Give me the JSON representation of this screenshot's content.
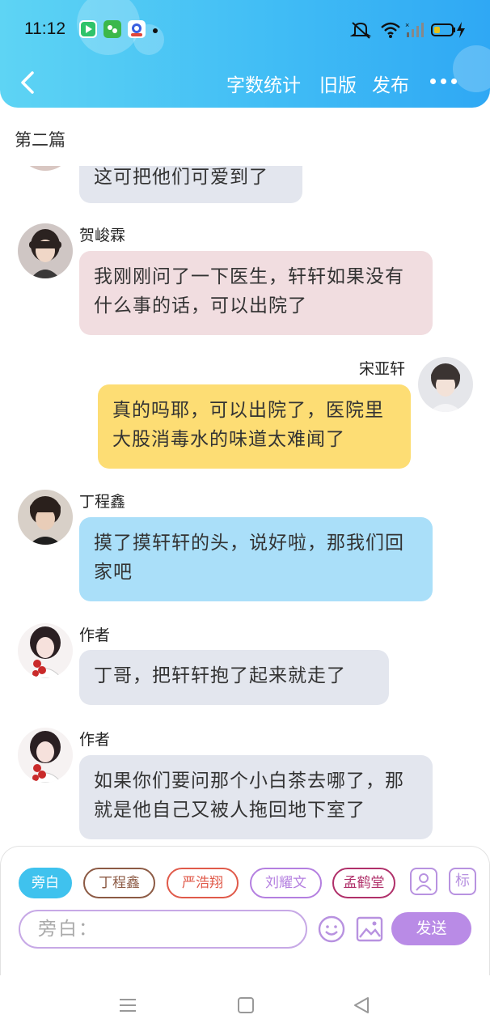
{
  "status_bar": {
    "time": "11:12"
  },
  "nav": {
    "items": [
      {
        "label": "字数统计"
      },
      {
        "label": "旧版"
      },
      {
        "label": "发布"
      }
    ]
  },
  "subtitle": "第二篇",
  "messages": [
    {
      "speaker": "",
      "text": "这可把他们可爱到了",
      "color": "#e3e6ee"
    },
    {
      "speaker": "贺峻霖",
      "text": "我刚刚问了一下医生，轩轩如果没有什么事的话，可以出院了",
      "color": "#f1dde0"
    },
    {
      "speaker": "宋亚轩",
      "text": "真的吗耶，可以出院了，医院里大股消毒水的味道太难闻了",
      "color": "#fddd74"
    },
    {
      "speaker": "丁程鑫",
      "text": "摸了摸轩轩的头，说好啦，那我们回家吧",
      "color": "#aadff9"
    },
    {
      "speaker": "作者",
      "text": "丁哥，把轩轩抱了起来就走了",
      "color": "#e3e6ee"
    },
    {
      "speaker": "作者",
      "text": "如果你们要问那个小白茶去哪了，那就是他自己又被人拖回地下室了",
      "color": "#e3e6ee"
    }
  ],
  "composer": {
    "chips": [
      {
        "label": "旁白",
        "color": "#3fc2ee"
      },
      {
        "label": "丁程鑫",
        "color": "#8c5a44"
      },
      {
        "label": "严浩翔",
        "color": "#e05a4a"
      },
      {
        "label": "刘耀文",
        "color": "#b47fe0"
      },
      {
        "label": "孟鹤堂",
        "color": "#b0306a"
      }
    ],
    "mark_label": "标",
    "input_placeholder": "旁白：",
    "send_label": "发送"
  }
}
